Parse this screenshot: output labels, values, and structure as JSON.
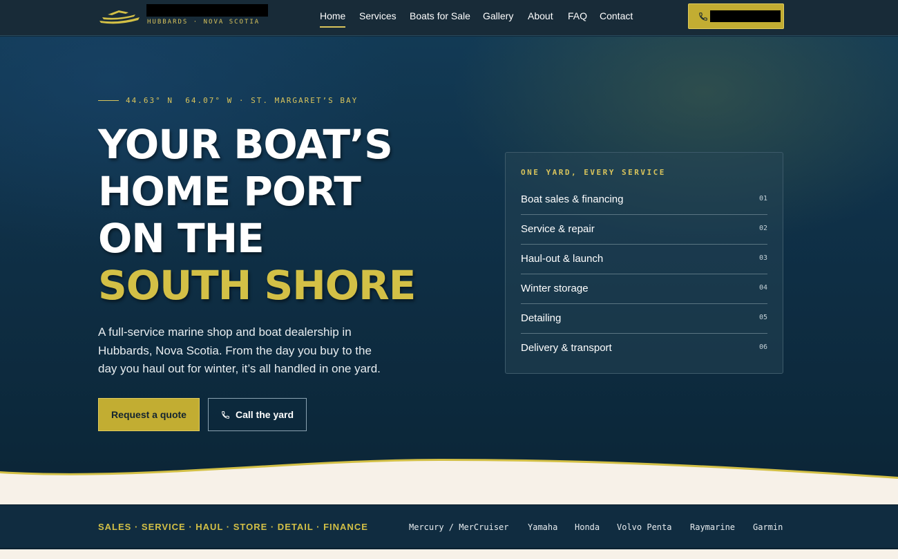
{
  "header": {
    "logo_subtitle": "HUBBARDS · NOVA SCOTIA",
    "nav": [
      {
        "label": "Home",
        "active": true
      },
      {
        "label": "Services"
      },
      {
        "label": "Boats for Sale"
      },
      {
        "label": "Gallery"
      },
      {
        "label": "About"
      },
      {
        "label": "FAQ"
      },
      {
        "label": "Contact"
      }
    ],
    "phone_icon": "phone-icon"
  },
  "hero": {
    "coordinates": "44.63° N  64.07° W · ST. MARGARET’S BAY",
    "headline_lines": [
      "YOUR BOAT’S",
      "HOME PORT",
      "ON THE"
    ],
    "headline_accent": "SOUTH SHORE",
    "intro": "A full-service marine shop and boat dealership in Hubbards, Nova Scotia. From the day you buy to the day you haul out for winter, it’s all handled in one yard.",
    "primary_cta": "Request a quote",
    "secondary_cta": "Call the yard"
  },
  "services_panel": {
    "title": "ONE YARD, EVERY SERVICE",
    "items": [
      {
        "label": "Boat sales & financing",
        "num": "01"
      },
      {
        "label": "Service & repair",
        "num": "02"
      },
      {
        "label": "Haul-out & launch",
        "num": "03"
      },
      {
        "label": "Winter storage",
        "num": "04"
      },
      {
        "label": "Detailing",
        "num": "05"
      },
      {
        "label": "Delivery & transport",
        "num": "06"
      }
    ]
  },
  "strip": {
    "tagline": "SALES · SERVICE · HAUL · STORE · DETAIL · FINANCE",
    "brands": [
      "Mercury / MerCruiser",
      "Yamaha",
      "Honda",
      "Volvo Penta",
      "Raymarine",
      "Garmin"
    ]
  },
  "colors": {
    "accent": "#d3c046",
    "button": "#c2ad32",
    "hero_dark": "#0f2a3c",
    "cream": "#f7f1e8"
  }
}
